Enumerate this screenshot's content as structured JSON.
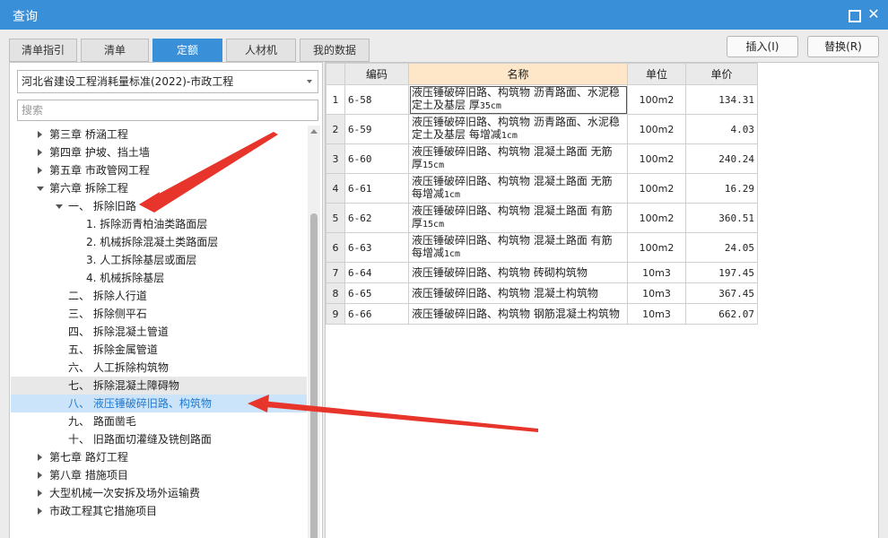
{
  "window": {
    "title": "查询",
    "maximize_icon": "maximize-icon",
    "close_icon": "close-icon"
  },
  "tabs": [
    {
      "label": "清单指引",
      "active": false
    },
    {
      "label": "清单",
      "active": false
    },
    {
      "label": "定额",
      "active": true
    },
    {
      "label": "人材机",
      "active": false
    },
    {
      "label": "我的数据",
      "active": false
    }
  ],
  "actions": {
    "insert": "插入(I)",
    "replace": "替换(R)"
  },
  "left": {
    "library": "河北省建设工程消耗量标准(2022)-市政工程",
    "search_placeholder": "搜索",
    "tree": [
      {
        "label": "第三章 桥涵工程",
        "expander": "collapsed"
      },
      {
        "label": "第四章 护坡、挡土墙",
        "expander": "collapsed"
      },
      {
        "label": "第五章 市政管网工程",
        "expander": "collapsed"
      },
      {
        "label": "第六章 拆除工程",
        "expander": "expanded"
      },
      {
        "label": "一、 拆除旧路",
        "expander": "expanded"
      },
      {
        "label": "1. 拆除沥青柏油类路面层",
        "expander": "none"
      },
      {
        "label": "2. 机械拆除混凝土类路面层",
        "expander": "none"
      },
      {
        "label": "3. 人工拆除基层或面层",
        "expander": "none"
      },
      {
        "label": "4. 机械拆除基层",
        "expander": "none"
      },
      {
        "label": "二、 拆除人行道",
        "expander": "none"
      },
      {
        "label": "三、 拆除侧平石",
        "expander": "none"
      },
      {
        "label": "四、 拆除混凝土管道",
        "expander": "none"
      },
      {
        "label": "五、 拆除金属管道",
        "expander": "none"
      },
      {
        "label": "六、 人工拆除构筑物",
        "expander": "none"
      },
      {
        "label": "七、 拆除混凝土障碍物",
        "expander": "none",
        "state": "hover"
      },
      {
        "label": "八、 液压锤破碎旧路、构筑物",
        "expander": "none",
        "state": "selected"
      },
      {
        "label": "九、 路面凿毛",
        "expander": "none"
      },
      {
        "label": "十、 旧路面切灌缝及铣刨路面",
        "expander": "none"
      },
      {
        "label": "第七章 路灯工程",
        "expander": "collapsed"
      },
      {
        "label": "第八章 措施项目",
        "expander": "collapsed"
      },
      {
        "label": "大型机械一次安拆及场外运输费",
        "expander": "collapsed"
      },
      {
        "label": "市政工程其它措施项目",
        "expander": "collapsed"
      }
    ]
  },
  "grid": {
    "headers": {
      "num": "",
      "code": "编码",
      "name": "名称",
      "unit": "单位",
      "price": "单价"
    },
    "rows": [
      {
        "num": "1",
        "code": "6-58",
        "name1": "液压锤破碎旧路、构筑物 沥青路面、水泥稳",
        "name2": "定土及基层 厚",
        "name2s": "35cm",
        "unit": "100m2",
        "price": "134.31"
      },
      {
        "num": "2",
        "code": "6-59",
        "name1": "液压锤破碎旧路、构筑物 沥青路面、水泥稳",
        "name2": "定土及基层 每增减",
        "name2s": "1cm",
        "unit": "100m2",
        "price": "4.03"
      },
      {
        "num": "3",
        "code": "6-60",
        "name1": "液压锤破碎旧路、构筑物 混凝土路面 无筋",
        "name2": "厚",
        "name2s": "15cm",
        "unit": "100m2",
        "price": "240.24"
      },
      {
        "num": "4",
        "code": "6-61",
        "name1": "液压锤破碎旧路、构筑物 混凝土路面 无筋",
        "name2": "每增减",
        "name2s": "1cm",
        "unit": "100m2",
        "price": "16.29"
      },
      {
        "num": "5",
        "code": "6-62",
        "name1": "液压锤破碎旧路、构筑物 混凝土路面 有筋",
        "name2": "厚",
        "name2s": "15cm",
        "unit": "100m2",
        "price": "360.51"
      },
      {
        "num": "6",
        "code": "6-63",
        "name1": "液压锤破碎旧路、构筑物 混凝土路面 有筋",
        "name2": "每增减",
        "name2s": "1cm",
        "unit": "100m2",
        "price": "24.05"
      },
      {
        "num": "7",
        "code": "6-64",
        "name1": "液压锤破碎旧路、构筑物 砖砌构筑物",
        "name2": "",
        "name2s": "",
        "unit": "10m3",
        "price": "197.45"
      },
      {
        "num": "8",
        "code": "6-65",
        "name1": "液压锤破碎旧路、构筑物 混凝土构筑物",
        "name2": "",
        "name2s": "",
        "unit": "10m3",
        "price": "367.45"
      },
      {
        "num": "9",
        "code": "6-66",
        "name1": "液压锤破碎旧路、构筑物 钢筋混凝土构筑物",
        "name2": "",
        "name2s": "",
        "unit": "10m3",
        "price": "662.07"
      }
    ]
  },
  "colors": {
    "accent": "#3a8fd9",
    "selected_bg": "#cbe4f9",
    "selected_text": "#1f78d1",
    "name_header_bg": "#fde7c8",
    "annotation": "#e8352b"
  },
  "icons": {
    "dropdown": "chevron-down-icon",
    "tree_collapsed": "caret-right-icon",
    "tree_expanded": "caret-down-icon",
    "annotation": "arrow-icon"
  }
}
